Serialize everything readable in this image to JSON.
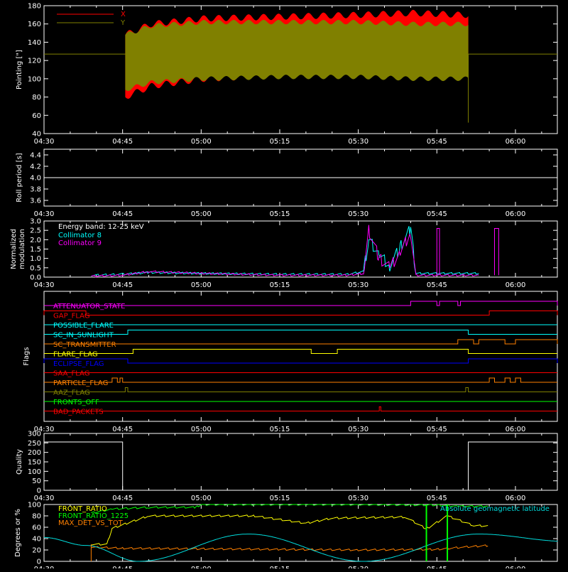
{
  "x_axis": {
    "start": "04:30",
    "end": "06:08",
    "ticks": [
      "04:30",
      "04:45",
      "05:00",
      "05:15",
      "05:30",
      "05:45",
      "06:00"
    ]
  },
  "panels": {
    "pointing": {
      "ylabel": "Pointing [\"]",
      "ylim": [
        40,
        180
      ],
      "yticks": [
        "40",
        "60",
        "80",
        "100",
        "120",
        "140",
        "160",
        "180"
      ]
    },
    "roll": {
      "ylabel": "Roll period [s]",
      "ylim": [
        3.5,
        4.5
      ],
      "yticks": [
        "3.6",
        "3.8",
        "4.0",
        "4.2",
        "4.4"
      ]
    },
    "modulation": {
      "ylabel": [
        "Normalized",
        "modulation"
      ],
      "ylim": [
        0,
        3
      ],
      "yticks": [
        "0.0",
        "0.5",
        "1.0",
        "1.5",
        "2.0",
        "2.5",
        "3.0"
      ],
      "note": "Energy band: 12-25 keV"
    },
    "flags": {
      "ylabel": "Flags"
    },
    "quality": {
      "ylabel": "Quality",
      "ylim": [
        0,
        300
      ],
      "yticks": [
        "0",
        "50",
        "100",
        "150",
        "200",
        "250",
        "300"
      ]
    },
    "degrees": {
      "ylabel": "Degrees or %",
      "ylim": [
        0,
        100
      ],
      "yticks": [
        "0",
        "20",
        "40",
        "60",
        "80",
        "100"
      ],
      "note": "Absolute geomagnetic latitude"
    }
  },
  "chart_data": [
    {
      "type": "area",
      "panel": "pointing",
      "series": [
        {
          "name": "X",
          "color": "#ff0000",
          "start": "04:45:30",
          "end": "05:51:00",
          "upper": [
            [
              0,
              148
            ],
            [
              5,
              160
            ],
            [
              15,
              166
            ],
            [
              30,
              168
            ],
            [
              45,
              170
            ],
            [
              55,
              172
            ],
            [
              64,
              170
            ]
          ],
          "lower": [
            [
              0,
              80
            ],
            [
              5,
              92
            ],
            [
              15,
              100
            ],
            [
              30,
              104
            ],
            [
              45,
              106
            ],
            [
              55,
              108
            ],
            [
              64,
              105
            ]
          ]
        },
        {
          "name": "Y",
          "color": "#808000",
          "start": "04:45:30",
          "end": "05:51:00",
          "upper": [
            [
              0,
              148
            ],
            [
              5,
              158
            ],
            [
              15,
              162
            ],
            [
              30,
              162
            ],
            [
              45,
              162
            ],
            [
              55,
              160
            ],
            [
              64,
              160
            ]
          ],
          "lower": [
            [
              0,
              88
            ],
            [
              5,
              96
            ],
            [
              15,
              100
            ],
            [
              30,
              102
            ],
            [
              45,
              102
            ],
            [
              55,
              100
            ],
            [
              64,
              100
            ]
          ]
        }
      ],
      "baseline": 127,
      "end_dip": 52
    },
    {
      "type": "line",
      "panel": "roll",
      "series": [
        {
          "name": "",
          "color": "#ffffff",
          "value": 4.0
        }
      ]
    },
    {
      "type": "line",
      "panel": "modulation",
      "series": [
        {
          "name": "Collimator 8",
          "color": "#00ffff",
          "points": [
            [
              "04:39",
              0.1
            ],
            [
              "04:45",
              0.15
            ],
            [
              "04:50",
              0.25
            ],
            [
              "05:00",
              0.2
            ],
            [
              "05:15",
              0.15
            ],
            [
              "05:28",
              0.15
            ],
            [
              "05:31",
              0.3
            ],
            [
              "05:32",
              2.0
            ],
            [
              "05:34",
              1.2
            ],
            [
              "05:36",
              0.6
            ],
            [
              "05:38",
              1.6
            ],
            [
              "05:40",
              2.6
            ],
            [
              "05:41",
              0.2
            ],
            [
              "05:53",
              0.2
            ]
          ]
        },
        {
          "name": "Collimator 9",
          "color": "#ff00ff",
          "points": [
            [
              "04:39",
              0.05
            ],
            [
              "04:45",
              0.1
            ],
            [
              "04:50",
              0.3
            ],
            [
              "05:00",
              0.2
            ],
            [
              "05:15",
              0.1
            ],
            [
              "05:28",
              0.1
            ],
            [
              "05:31",
              0.2
            ],
            [
              "05:32",
              2.5
            ],
            [
              "05:34",
              1.0
            ],
            [
              "05:36",
              0.5
            ],
            [
              "05:38",
              1.3
            ],
            [
              "05:40",
              2.4
            ],
            [
              "05:41",
              0.1
            ],
            [
              "05:53",
              0.1
            ]
          ]
        }
      ],
      "spikes": [
        {
          "time": "05:45",
          "value": 2.6,
          "width_min": 0.5
        },
        {
          "time": "05:56",
          "value": 2.6,
          "width_min": 0.8
        }
      ]
    },
    {
      "type": "line",
      "panel": "flags",
      "flags": [
        {
          "name": "ATTENUATOR_STATE",
          "color": "#ff00ff",
          "high": [
            [
              "05:40",
              "05:45"
            ],
            [
              "05:45.5",
              "05:49"
            ],
            [
              "05:49.5",
              "06:10"
            ]
          ]
        },
        {
          "name": "GAP_FLAG",
          "color": "#ff0000",
          "high": [
            [
              "04:30",
              "04:38"
            ],
            [
              "05:55",
              "06:10"
            ]
          ]
        },
        {
          "name": "POSSIBLE_FLARE",
          "color": "#00ffff",
          "high": []
        },
        {
          "name": "SC_IN_SUNLIGHT",
          "color": "#00ffff",
          "high": [
            [
              "04:46",
              "05:51"
            ]
          ]
        },
        {
          "name": "SC_TRANSMITTER",
          "color": "#ff8000",
          "high": [
            [
              "05:49",
              "05:52"
            ],
            [
              "05:53",
              "05:58"
            ],
            [
              "06:00",
              "06:10"
            ]
          ]
        },
        {
          "name": "FLARE_FLAG",
          "color": "#ffff00",
          "high": [
            [
              "04:47",
              "05:21"
            ],
            [
              "05:26",
              "05:51"
            ]
          ]
        },
        {
          "name": "ECLIPSE_FLAG",
          "color": "#0000ff",
          "high": [
            [
              "04:30",
              "04:46"
            ],
            [
              "05:51",
              "06:10"
            ]
          ]
        },
        {
          "name": "SAA_FLAG",
          "color": "#ff0000",
          "high": []
        },
        {
          "name": "PARTICLE_FLAG",
          "color": "#ff8000",
          "high": [
            [
              "04:43",
              "04:44"
            ],
            [
              "04:44.5",
              "04:45"
            ],
            [
              "05:55",
              "05:56"
            ],
            [
              "05:58",
              "05:59"
            ],
            [
              "06:00",
              "06:01"
            ]
          ]
        },
        {
          "name": "AAZ_FLAG",
          "color": "#808000",
          "high": [
            [
              "04:45.5",
              "04:46"
            ],
            [
              "05:50.5",
              "05:51"
            ]
          ]
        },
        {
          "name": "FRONTS_OFF",
          "color": "#00ff00",
          "high": []
        },
        {
          "name": "BAD_PACKETS",
          "color": "#ff0000",
          "high": [
            [
              "05:34",
              "05:34.3"
            ]
          ]
        }
      ]
    },
    {
      "type": "line",
      "panel": "quality",
      "series": [
        {
          "name": "",
          "color": "#ffffff",
          "points": [
            [
              "04:30",
              255
            ],
            [
              "04:45",
              255
            ],
            [
              "04:45",
              0
            ],
            [
              "05:51",
              0
            ],
            [
              "05:51",
              255
            ],
            [
              "06:10",
              255
            ]
          ]
        }
      ]
    },
    {
      "type": "line",
      "panel": "degrees",
      "series": [
        {
          "name": "FRONT_RATIO",
          "color": "#ffff00",
          "points": [
            [
              "04:39",
              30
            ],
            [
              "04:42",
              30
            ],
            [
              "04:43",
              58
            ],
            [
              "04:50",
              80
            ],
            [
              "05:10",
              80
            ],
            [
              "05:20",
              67
            ],
            [
              "05:25",
              76
            ],
            [
              "05:39",
              78
            ],
            [
              "05:43",
              57
            ],
            [
              "05:47",
              80
            ],
            [
              "05:52",
              63
            ],
            [
              "05:55",
              62
            ]
          ]
        },
        {
          "name": "FRONT_RATIO_1225",
          "color": "#00ff00",
          "points": [
            [
              "04:39",
              85
            ],
            [
              "04:43",
              92
            ],
            [
              "04:50",
              95
            ],
            [
              "04:59",
              95
            ],
            [
              "05:00",
              100
            ],
            [
              "05:20",
              100
            ],
            [
              "05:30",
              100
            ],
            [
              "05:45",
              99
            ],
            [
              "05:49",
              97
            ],
            [
              "05:55",
              97
            ]
          ]
        },
        {
          "name": "MAX_DET_VS_TOT",
          "color": "#ff8000",
          "points": [
            [
              "04:39",
              25
            ],
            [
              "04:45",
              23
            ],
            [
              "05:00",
              22
            ],
            [
              "05:15",
              21
            ],
            [
              "05:30",
              20
            ],
            [
              "05:45",
              21
            ],
            [
              "05:50",
              25
            ],
            [
              "05:55",
              28
            ]
          ]
        },
        {
          "name": "Absolute geomagnetic latitude",
          "color": "#00dddd",
          "points": [
            [
              "04:30",
              42
            ],
            [
              "04:38",
              28
            ],
            [
              "04:48",
              0
            ],
            [
              "05:09",
              48
            ],
            [
              "05:31",
              0
            ],
            [
              "05:53",
              48
            ],
            [
              "06:10",
              35
            ]
          ]
        }
      ],
      "green_vlines": [
        "05:43",
        "05:47"
      ]
    }
  ]
}
